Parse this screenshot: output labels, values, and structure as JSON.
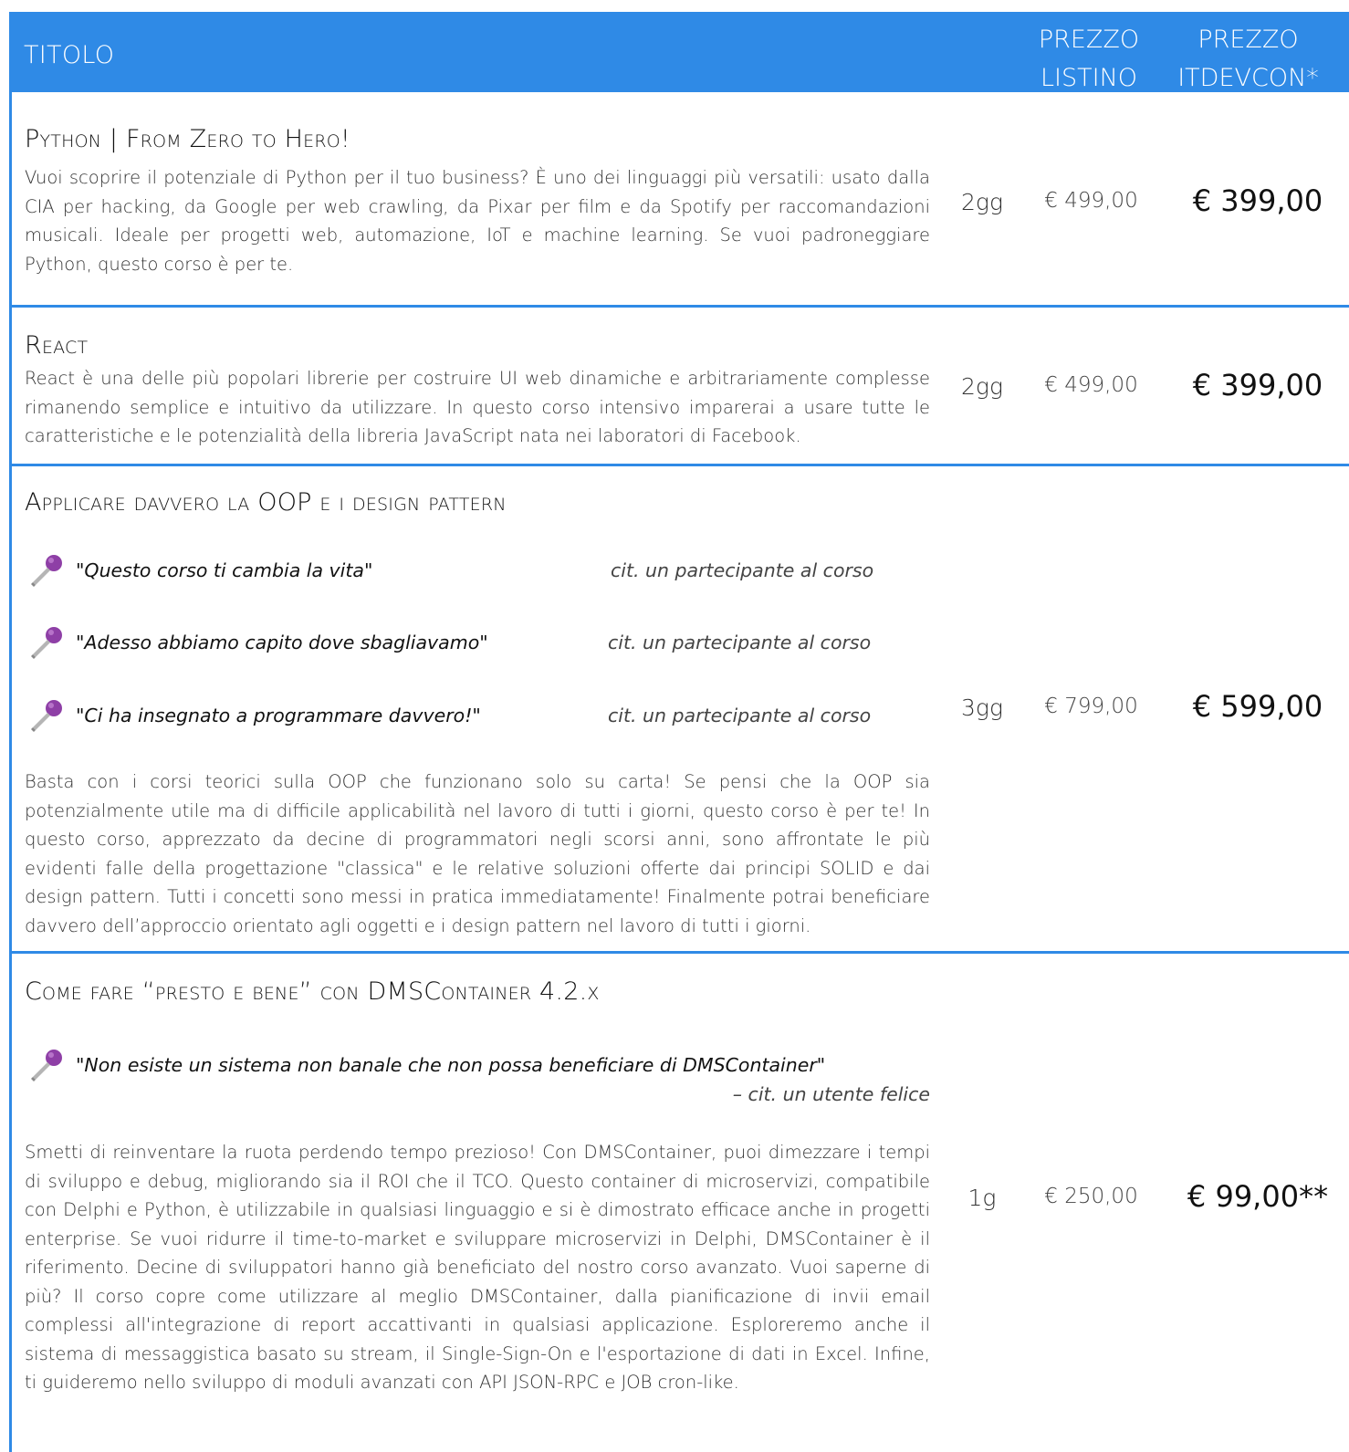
{
  "header": {
    "title": "TITOLO",
    "price_list_line1": "PREZZO",
    "price_list_line2": "LISTINO",
    "price_itdevcon_line1": "PREZZO",
    "price_itdevcon_line2": "ITDEVCON*"
  },
  "colors": {
    "accent": "#2f8ae6",
    "header_text": "#ffffff"
  },
  "courses": [
    {
      "title_caps": [
        "P",
        "YTHON | ",
        "F",
        "ROM ",
        "Z",
        "ERO TO ",
        "H",
        "ERO!"
      ],
      "title": "Python | From Zero to Hero!",
      "description": "Vuoi scoprire il potenziale di Python per il tuo business? È uno dei linguaggi più versatili: usato dalla CIA per hacking, da Google per web crawling, da Pixar per film e da Spotify per raccomandazioni musicali. Ideale per progetti web, automazione, IoT e machine learning. Se vuoi padroneggiare Python, questo corso è per te.",
      "duration": "2gg",
      "price_list": "€ 499,00",
      "price_itdevcon": "€ 399,00"
    },
    {
      "title": "React",
      "description": "React è una delle più popolari librerie per costruire UI web dinamiche e arbitrariamente complesse rimanendo semplice e intuitivo da utilizzare. In questo corso intensivo imparerai a usare tutte le caratteristiche e le potenzialità della libreria JavaScript nata nei laboratori di Facebook.",
      "duration": "2gg",
      "price_list": "€ 499,00",
      "price_itdevcon": "€ 399,00"
    },
    {
      "title": "Applicare davvero la OOP e i design pattern",
      "quotes": [
        {
          "text": "\"Questo corso ti cambia la vita\"",
          "cite": "cit. un partecipante al corso"
        },
        {
          "text": "\"Adesso abbiamo capito dove sbagliavamo\"",
          "cite": "cit. un partecipante al corso"
        },
        {
          "text": "\"Ci ha insegnato a programmare davvero!\"",
          "cite": "cit. un partecipante al corso"
        }
      ],
      "description": "Basta con i corsi teorici sulla OOP che funzionano solo su carta! Se pensi che la OOP sia potenzialmente utile ma di difficile applicabilità nel lavoro di tutti i giorni, questo corso è per te! In questo corso, apprezzato da decine di programmatori negli scorsi anni, sono affrontate le più evidenti falle della progettazione \"classica\" e le relative soluzioni offerte dai principi SOLID e dai design pattern. Tutti i concetti sono messi in pratica immediatamente! Finalmente potrai beneficiare davvero dell’approccio orientato agli oggetti e i design pattern nel lavoro di tutti i giorni.",
      "duration": "3gg",
      "price_list": "€ 799,00",
      "price_itdevcon": "€ 599,00"
    },
    {
      "title": "Come fare “presto e bene” con DMSContainer 4.2.x",
      "quote": {
        "text": "\"Non esiste un sistema non banale che non possa beneficiare di DMSContainer\"",
        "cite": "– cit. un utente felice"
      },
      "description": "Smetti di reinventare la ruota perdendo tempo prezioso! Con DMSContainer, puoi dimezzare i tempi di sviluppo e debug, migliorando sia il ROI che il TCO. Questo container di microservizi, compatibile con Delphi e Python, è utilizzabile in qualsiasi linguaggio e si è dimostrato efficace anche in progetti enterprise. Se vuoi ridurre il time-to-market e sviluppare microservizi in Delphi, DMSContainer è il riferimento. Decine di sviluppatori hanno già beneficiato del nostro corso avanzato. Vuoi saperne di più? Il corso copre come utilizzare al meglio DMSContainer, dalla pianificazione di invii email complessi all'integrazione di report accattivanti in qualsiasi applicazione. Esploreremo anche il sistema di messaggistica basato su stream, il Single-Sign-On e l'esportazione di dati in Excel. Infine, ti guideremo nello sviluppo di moduli avanzati con API JSON-RPC e JOB cron-like.",
      "duration": "1g",
      "price_list": "€ 250,00",
      "price_itdevcon": "€ 99,00**"
    }
  ]
}
